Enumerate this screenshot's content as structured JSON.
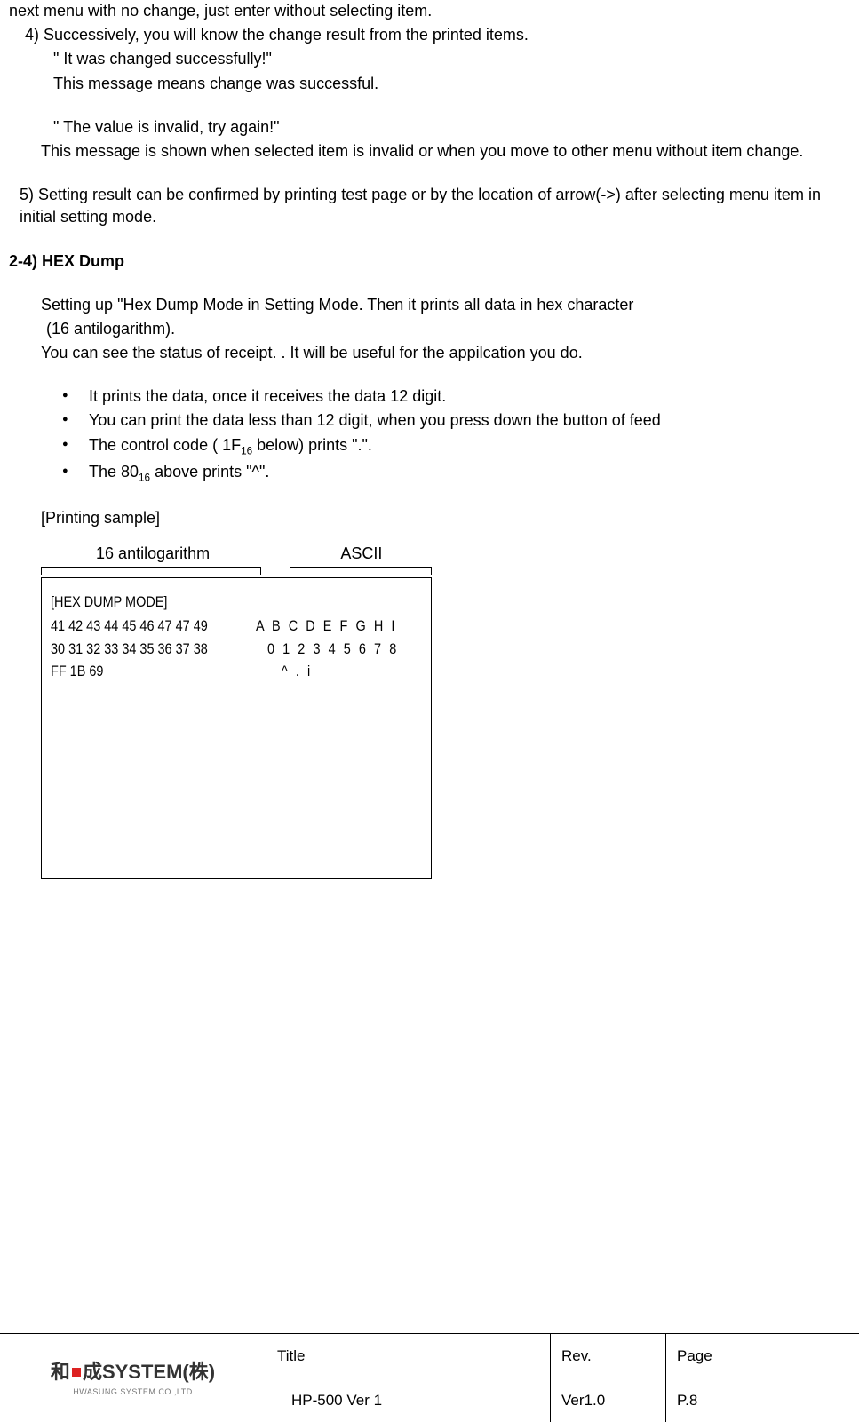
{
  "body": {
    "line1": "next menu with no change, just enter without selecting item.",
    "step4": "4) Successively, you will know the change result from the printed items.",
    "step4_q1": "\" It was changed successfully!\"",
    "step4_m1": "This message means change was successful.",
    "step4_q2": "\" The value is invalid, try again!\"",
    "step4_m2": "This message is shown when selected item is invalid or when you move to other menu without item change.",
    "step5": "5) Setting result can be confirmed by printing test page or by the location of arrow(->) after selecting menu item in initial setting mode.",
    "section": "2-4) HEX Dump",
    "hex_intro1": "Setting up \"Hex Dump Mode in Setting Mode. Then it prints all data in hex character",
    "hex_intro1b": "(16 antilogarithm).",
    "hex_intro2": "You can see the status of receipt. . It will be useful for the appilcation you do.",
    "bullets": [
      "It prints the data, once it receives the data 12 digit.",
      "You can print the data less than 12 digit, when you press down the button of feed",
      "The control code ( 1F",
      " below) prints \".\".",
      "The 80",
      " above prints \"^\"."
    ],
    "sub16": "16",
    "printing_sample": "[Printing sample]",
    "col_hex": "16 antilogarithm",
    "col_ascii": "ASCII",
    "hex_dump_title": "[HEX DUMP MODE]",
    "rows": [
      {
        "hex": "41 42 43 44 45 46 47 47 49",
        "ascii": "A B C D E F G H I"
      },
      {
        "hex": "30 31 32 33 34 35 36 37 38",
        "ascii": "0 1 2 3 4 5 6 7 8"
      },
      {
        "hex": "FF 1B 69",
        "ascii": "^ . i"
      }
    ]
  },
  "footer": {
    "logo_text": "成SYSTEM(株)",
    "logo_prefix": "和",
    "logo_sub": "HWASUNG SYSTEM CO.,LTD",
    "h_title": "Title",
    "h_rev": "Rev.",
    "h_page": "Page",
    "v_title": "HP-500 Ver 1",
    "v_rev": "Ver1.0",
    "v_page": "P.8"
  }
}
